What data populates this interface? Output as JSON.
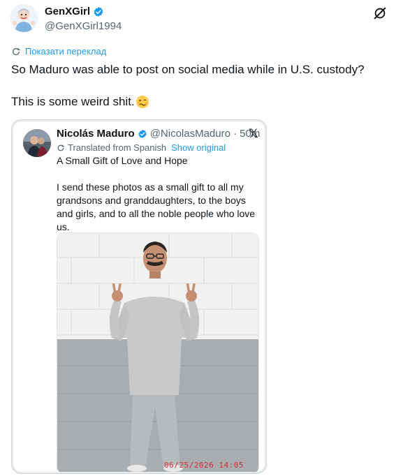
{
  "author": {
    "display_name": "GenXGirl",
    "handle": "@GenXGirl1994",
    "verified": true,
    "avatar_icon": "cartoon-avatar-icon"
  },
  "translate_link": "Показати переклад",
  "tweet": {
    "line1": "So Maduro was able to post on social media while in U.S. custody?",
    "line2": "This is some weird shit.",
    "emoji": "woozy-face-emoji"
  },
  "quoted": {
    "display_name": "Nicolás Maduro",
    "handle": "@NicolasMaduro",
    "time": "· 50m",
    "x_logo": "𝕏",
    "translated_label": "Translated from Spanish",
    "show_original": "Show original",
    "title": "A Small Gift of Love and Hope",
    "body": "I send these photos as a small gift to all my grandsons and granddaughters, to the boys and girls, and to all the noble people who love us.",
    "photo_timestamp": "06/25/2026 14:05"
  },
  "colors": {
    "accent": "#1d9bf0",
    "text": "#0f1419",
    "muted": "#536471"
  }
}
